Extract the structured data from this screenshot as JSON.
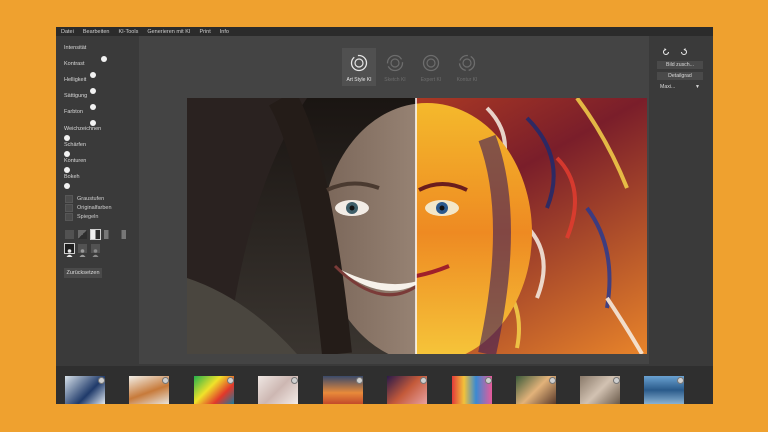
{
  "menu": [
    "Datei",
    "Bearbeiten",
    "KI-Tools",
    "Generieren mit KI",
    "Print",
    "Info"
  ],
  "sliders": [
    {
      "label": "Intensität",
      "level": 0.72
    },
    {
      "label": "Kontrast",
      "level": 0.5
    },
    {
      "label": "Helligkeit",
      "level": 0.5
    },
    {
      "label": "Sättigung",
      "level": 0.5
    },
    {
      "label": "Farbton",
      "level": 0.5
    },
    {
      "label": "Weichzeichnen",
      "level": 0.0
    },
    {
      "label": "Schärfen",
      "level": 0.0
    },
    {
      "label": "Konturen",
      "level": 0.0
    },
    {
      "label": "Bokeh",
      "level": 0.0
    }
  ],
  "checkboxes": [
    {
      "label": "Graustufen",
      "checked": false
    },
    {
      "label": "Originalfarben",
      "checked": false
    },
    {
      "label": "Spiegeln",
      "checked": false
    }
  ],
  "reset_label": "Zurücksetzen",
  "style_tabs": [
    {
      "label": "Art Style KI",
      "active": true
    },
    {
      "label": "Sketch KI",
      "active": false
    },
    {
      "label": "Expert KI",
      "active": false
    },
    {
      "label": "Kontur KI",
      "active": false
    }
  ],
  "right_panel": {
    "undo_icon": "undo-icon",
    "redo_icon": "redo-icon",
    "fit_label": "Bild zusch...",
    "detail_label": "Detailgrad",
    "size_value": "Maxi..."
  },
  "colors": {
    "background": "#EFA12F",
    "app": "#3a3a3a",
    "menubar": "#2b2b2b",
    "stage": "#444444",
    "filmstrip": "#2f2f2f"
  },
  "thumbnails": [
    {
      "name": "thumb-1"
    },
    {
      "name": "thumb-2"
    },
    {
      "name": "thumb-3"
    },
    {
      "name": "thumb-4"
    },
    {
      "name": "thumb-5"
    },
    {
      "name": "thumb-6"
    },
    {
      "name": "thumb-7"
    },
    {
      "name": "thumb-8"
    },
    {
      "name": "thumb-9"
    },
    {
      "name": "thumb-10"
    }
  ]
}
